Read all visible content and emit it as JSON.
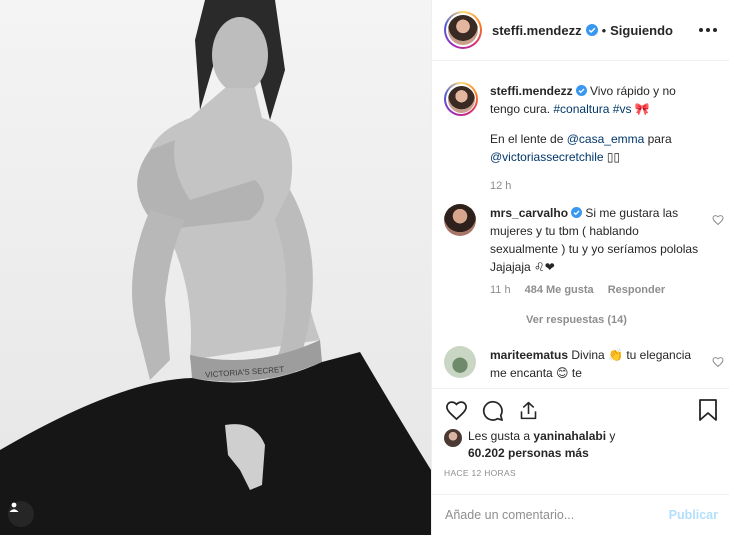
{
  "header": {
    "username": "steffi.mendezz",
    "dot": "•",
    "following_label": "Siguiendo"
  },
  "photo": {
    "waistband_text": "VICTORIA'S SECRET"
  },
  "caption": {
    "username": "steffi.mendezz",
    "text_1": " Vivo rápido y no tengo cura. ",
    "tag_conaltura": "#conaltura",
    "tag_vs": "#vs",
    "emoji_bow": "🎀",
    "text_2": "En el lente de ",
    "mention_casa": "@casa_emma",
    "text_3": " para",
    "mention_vs": "@victoriassecretchile",
    "emoji_end": "▯▯",
    "time": "12 h"
  },
  "comment1": {
    "username": "mrs_carvalho",
    "text": " Si me gustara las mujeres y tu tbm ( hablando sexualmente ) tu y yo seríamos pololas Jajajaja ♌❤",
    "time": "11 h",
    "likes": "484 Me gusta",
    "reply": "Responder",
    "view_replies": "Ver respuestas (14)"
  },
  "comment2": {
    "username": "mariteematus",
    "text": " Divina 👏 tu elegancia me encanta 😊 te"
  },
  "likes": {
    "prefix": "Les gusta a ",
    "user": "yaninahalabi",
    "middle": " y",
    "count": "60.202 personas más"
  },
  "timestamp": "HACE 12 HORAS",
  "add_comment": {
    "placeholder": "Añade un comentario...",
    "post_label": "Publicar"
  },
  "colors": {
    "link": "#00376b",
    "verified": "#3897f0",
    "muted": "#8e8e8e",
    "post_disabled": "#b2dffc"
  }
}
